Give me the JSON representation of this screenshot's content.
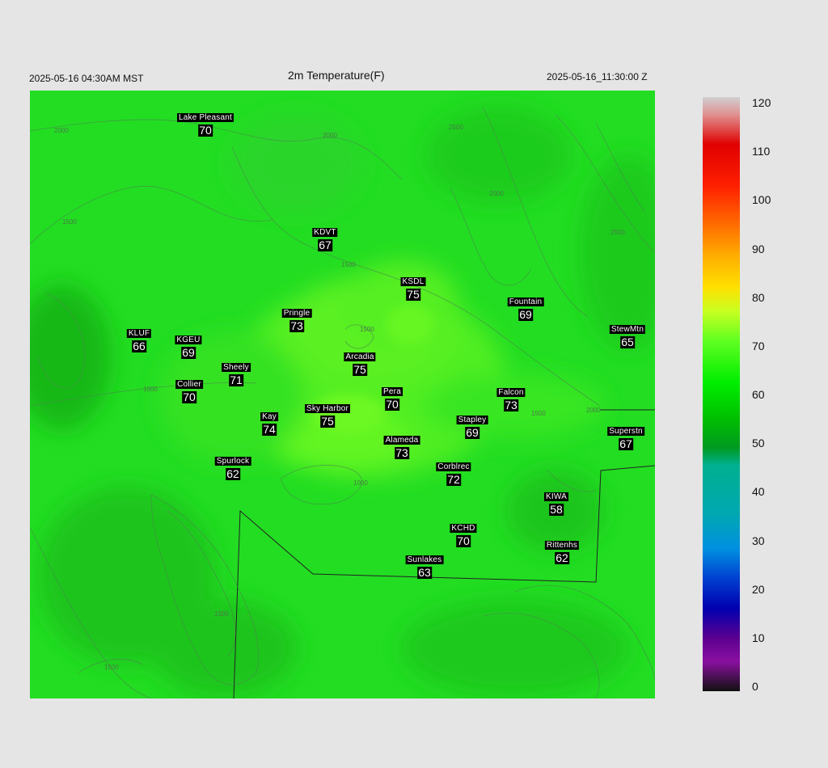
{
  "header": {
    "local_time": "2025-05-16 04:30AM MST",
    "title": "2m Temperature(F)",
    "utc_time": "2025-05-16_11:30:00 Z"
  },
  "map": {
    "variable": "2m Temperature",
    "units": "F",
    "contour_labels": [
      "2000",
      "2000",
      "1500",
      "1500",
      "1500",
      "1500",
      "1000",
      "1000",
      "1500",
      "2000",
      "2500",
      "2500",
      "1500",
      "2000"
    ],
    "stations": [
      {
        "name": "Lake Pleasant",
        "value": "70"
      },
      {
        "name": "KDVT",
        "value": "67"
      },
      {
        "name": "KSDL",
        "value": "75"
      },
      {
        "name": "Fountain",
        "value": "69"
      },
      {
        "name": "Pringle",
        "value": "73"
      },
      {
        "name": "KLUF",
        "value": "66"
      },
      {
        "name": "KGEU",
        "value": "69"
      },
      {
        "name": "StewMtn",
        "value": "65"
      },
      {
        "name": "Arcadia",
        "value": "75"
      },
      {
        "name": "Sheely",
        "value": "71"
      },
      {
        "name": "Collier",
        "value": "70"
      },
      {
        "name": "Pera",
        "value": "70"
      },
      {
        "name": "Falcon",
        "value": "73"
      },
      {
        "name": "Kay",
        "value": "74"
      },
      {
        "name": "Sky Harbor",
        "value": "75"
      },
      {
        "name": "Stapley",
        "value": "69"
      },
      {
        "name": "Superstn",
        "value": "67"
      },
      {
        "name": "Alameda",
        "value": "73"
      },
      {
        "name": "Spurlock",
        "value": "62"
      },
      {
        "name": "Corblrec",
        "value": "72"
      },
      {
        "name": "KIWA",
        "value": "58"
      },
      {
        "name": "KCHD",
        "value": "70"
      },
      {
        "name": "Rittenhs",
        "value": "62"
      },
      {
        "name": "Sunlakes",
        "value": "63"
      }
    ]
  },
  "colorbar": {
    "ticks": [
      "120",
      "110",
      "100",
      "90",
      "80",
      "70",
      "60",
      "50",
      "40",
      "30",
      "20",
      "10",
      "0"
    ],
    "colors": {
      "c120": "#d0d0d0",
      "c115": "#e09090",
      "c110": "#e00000",
      "c102": "#ff2000",
      "c97": "#ff6600",
      "c90": "#ffb000",
      "c85": "#ffe000",
      "c80": "#c8ff20",
      "c75": "#60ff20",
      "c70": "#00ee00",
      "c62": "#00c000",
      "c56": "#009a20",
      "c50": "#00b090",
      "c40": "#00a8b0",
      "c30": "#0090e0",
      "c23": "#0040d0",
      "c18": "#0000b0",
      "c12": "#5a0090",
      "c6": "#8a10a0",
      "c0": "#101010"
    }
  }
}
